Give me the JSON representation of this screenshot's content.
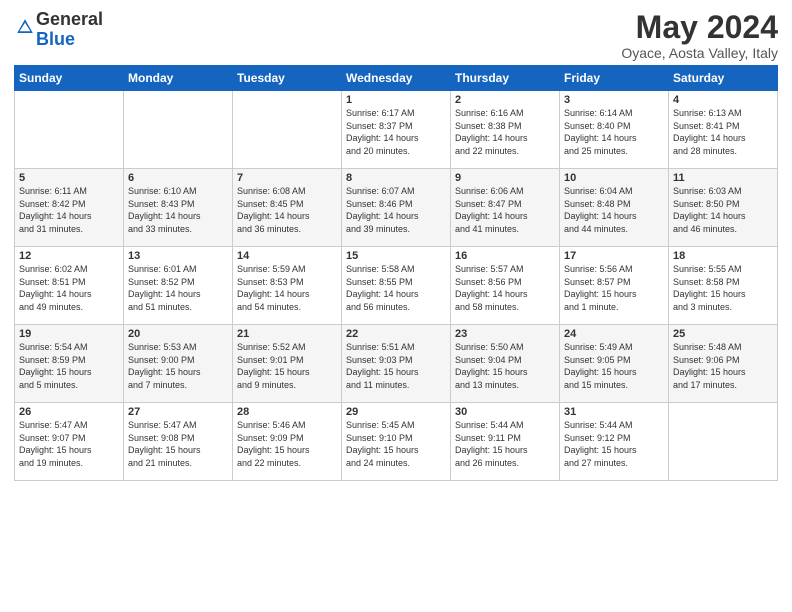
{
  "logo": {
    "general": "General",
    "blue": "Blue"
  },
  "title": "May 2024",
  "location": "Oyace, Aosta Valley, Italy",
  "weekdays": [
    "Sunday",
    "Monday",
    "Tuesday",
    "Wednesday",
    "Thursday",
    "Friday",
    "Saturday"
  ],
  "weeks": [
    [
      {
        "day": "",
        "info": ""
      },
      {
        "day": "",
        "info": ""
      },
      {
        "day": "",
        "info": ""
      },
      {
        "day": "1",
        "info": "Sunrise: 6:17 AM\nSunset: 8:37 PM\nDaylight: 14 hours\nand 20 minutes."
      },
      {
        "day": "2",
        "info": "Sunrise: 6:16 AM\nSunset: 8:38 PM\nDaylight: 14 hours\nand 22 minutes."
      },
      {
        "day": "3",
        "info": "Sunrise: 6:14 AM\nSunset: 8:40 PM\nDaylight: 14 hours\nand 25 minutes."
      },
      {
        "day": "4",
        "info": "Sunrise: 6:13 AM\nSunset: 8:41 PM\nDaylight: 14 hours\nand 28 minutes."
      }
    ],
    [
      {
        "day": "5",
        "info": "Sunrise: 6:11 AM\nSunset: 8:42 PM\nDaylight: 14 hours\nand 31 minutes."
      },
      {
        "day": "6",
        "info": "Sunrise: 6:10 AM\nSunset: 8:43 PM\nDaylight: 14 hours\nand 33 minutes."
      },
      {
        "day": "7",
        "info": "Sunrise: 6:08 AM\nSunset: 8:45 PM\nDaylight: 14 hours\nand 36 minutes."
      },
      {
        "day": "8",
        "info": "Sunrise: 6:07 AM\nSunset: 8:46 PM\nDaylight: 14 hours\nand 39 minutes."
      },
      {
        "day": "9",
        "info": "Sunrise: 6:06 AM\nSunset: 8:47 PM\nDaylight: 14 hours\nand 41 minutes."
      },
      {
        "day": "10",
        "info": "Sunrise: 6:04 AM\nSunset: 8:48 PM\nDaylight: 14 hours\nand 44 minutes."
      },
      {
        "day": "11",
        "info": "Sunrise: 6:03 AM\nSunset: 8:50 PM\nDaylight: 14 hours\nand 46 minutes."
      }
    ],
    [
      {
        "day": "12",
        "info": "Sunrise: 6:02 AM\nSunset: 8:51 PM\nDaylight: 14 hours\nand 49 minutes."
      },
      {
        "day": "13",
        "info": "Sunrise: 6:01 AM\nSunset: 8:52 PM\nDaylight: 14 hours\nand 51 minutes."
      },
      {
        "day": "14",
        "info": "Sunrise: 5:59 AM\nSunset: 8:53 PM\nDaylight: 14 hours\nand 54 minutes."
      },
      {
        "day": "15",
        "info": "Sunrise: 5:58 AM\nSunset: 8:55 PM\nDaylight: 14 hours\nand 56 minutes."
      },
      {
        "day": "16",
        "info": "Sunrise: 5:57 AM\nSunset: 8:56 PM\nDaylight: 14 hours\nand 58 minutes."
      },
      {
        "day": "17",
        "info": "Sunrise: 5:56 AM\nSunset: 8:57 PM\nDaylight: 15 hours\nand 1 minute."
      },
      {
        "day": "18",
        "info": "Sunrise: 5:55 AM\nSunset: 8:58 PM\nDaylight: 15 hours\nand 3 minutes."
      }
    ],
    [
      {
        "day": "19",
        "info": "Sunrise: 5:54 AM\nSunset: 8:59 PM\nDaylight: 15 hours\nand 5 minutes."
      },
      {
        "day": "20",
        "info": "Sunrise: 5:53 AM\nSunset: 9:00 PM\nDaylight: 15 hours\nand 7 minutes."
      },
      {
        "day": "21",
        "info": "Sunrise: 5:52 AM\nSunset: 9:01 PM\nDaylight: 15 hours\nand 9 minutes."
      },
      {
        "day": "22",
        "info": "Sunrise: 5:51 AM\nSunset: 9:03 PM\nDaylight: 15 hours\nand 11 minutes."
      },
      {
        "day": "23",
        "info": "Sunrise: 5:50 AM\nSunset: 9:04 PM\nDaylight: 15 hours\nand 13 minutes."
      },
      {
        "day": "24",
        "info": "Sunrise: 5:49 AM\nSunset: 9:05 PM\nDaylight: 15 hours\nand 15 minutes."
      },
      {
        "day": "25",
        "info": "Sunrise: 5:48 AM\nSunset: 9:06 PM\nDaylight: 15 hours\nand 17 minutes."
      }
    ],
    [
      {
        "day": "26",
        "info": "Sunrise: 5:47 AM\nSunset: 9:07 PM\nDaylight: 15 hours\nand 19 minutes."
      },
      {
        "day": "27",
        "info": "Sunrise: 5:47 AM\nSunset: 9:08 PM\nDaylight: 15 hours\nand 21 minutes."
      },
      {
        "day": "28",
        "info": "Sunrise: 5:46 AM\nSunset: 9:09 PM\nDaylight: 15 hours\nand 22 minutes."
      },
      {
        "day": "29",
        "info": "Sunrise: 5:45 AM\nSunset: 9:10 PM\nDaylight: 15 hours\nand 24 minutes."
      },
      {
        "day": "30",
        "info": "Sunrise: 5:44 AM\nSunset: 9:11 PM\nDaylight: 15 hours\nand 26 minutes."
      },
      {
        "day": "31",
        "info": "Sunrise: 5:44 AM\nSunset: 9:12 PM\nDaylight: 15 hours\nand 27 minutes."
      },
      {
        "day": "",
        "info": ""
      }
    ]
  ]
}
